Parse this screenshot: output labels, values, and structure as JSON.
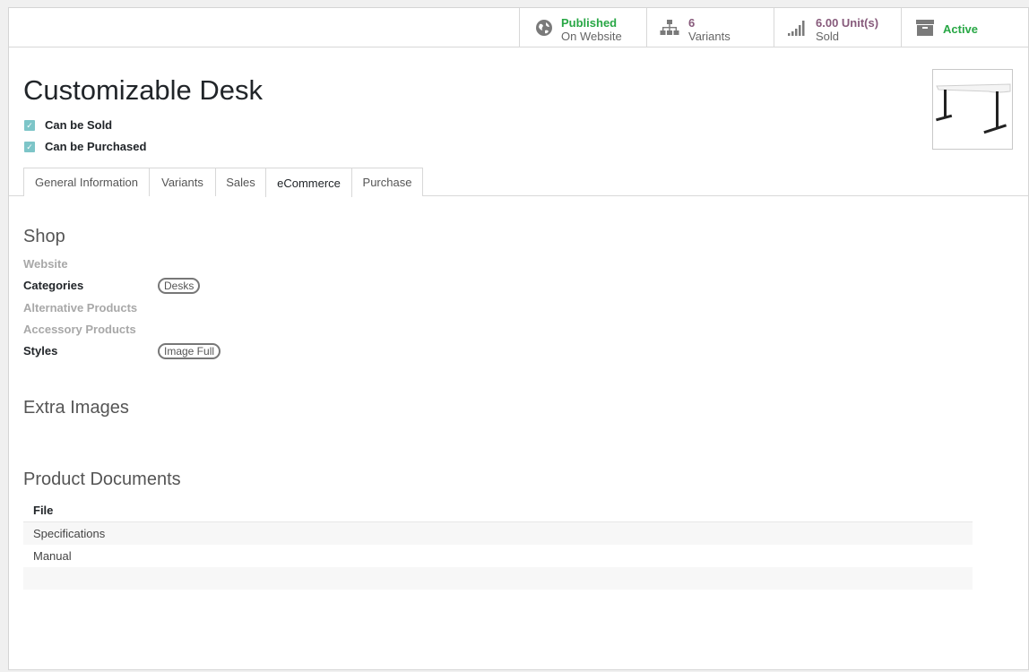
{
  "smart_buttons": {
    "published": {
      "line1": "Published",
      "line2": "On Website",
      "icon": "globe-icon"
    },
    "variants": {
      "line1": "6",
      "line2": "Variants",
      "icon": "sitemap-icon"
    },
    "sold": {
      "line1": "6.00 Unit(s)",
      "line2": "Sold",
      "icon": "signal-icon"
    },
    "active": {
      "label": "Active",
      "icon": "archive-icon"
    }
  },
  "product": {
    "name": "Customizable Desk",
    "can_be_sold_label": "Can be Sold",
    "can_be_purchased_label": "Can be Purchased",
    "can_be_sold": true,
    "can_be_purchased": true
  },
  "tabs": [
    {
      "label": "General Information"
    },
    {
      "label": "Variants"
    },
    {
      "label": "Sales"
    },
    {
      "label": "eCommerce",
      "active": true
    },
    {
      "label": "Purchase"
    }
  ],
  "shop": {
    "title": "Shop",
    "website_label": "Website",
    "categories_label": "Categories",
    "categories_tag": "Desks",
    "alternative_label": "Alternative Products",
    "accessory_label": "Accessory Products",
    "styles_label": "Styles",
    "styles_tag": "Image Full"
  },
  "extra_images": {
    "title": "Extra Images"
  },
  "documents": {
    "title": "Product Documents",
    "column": "File",
    "rows": [
      "Specifications",
      "Manual"
    ]
  },
  "colors": {
    "published_green": "#28a745",
    "brand_purple": "#875a7b",
    "checkbox": "#7dc5c8"
  }
}
